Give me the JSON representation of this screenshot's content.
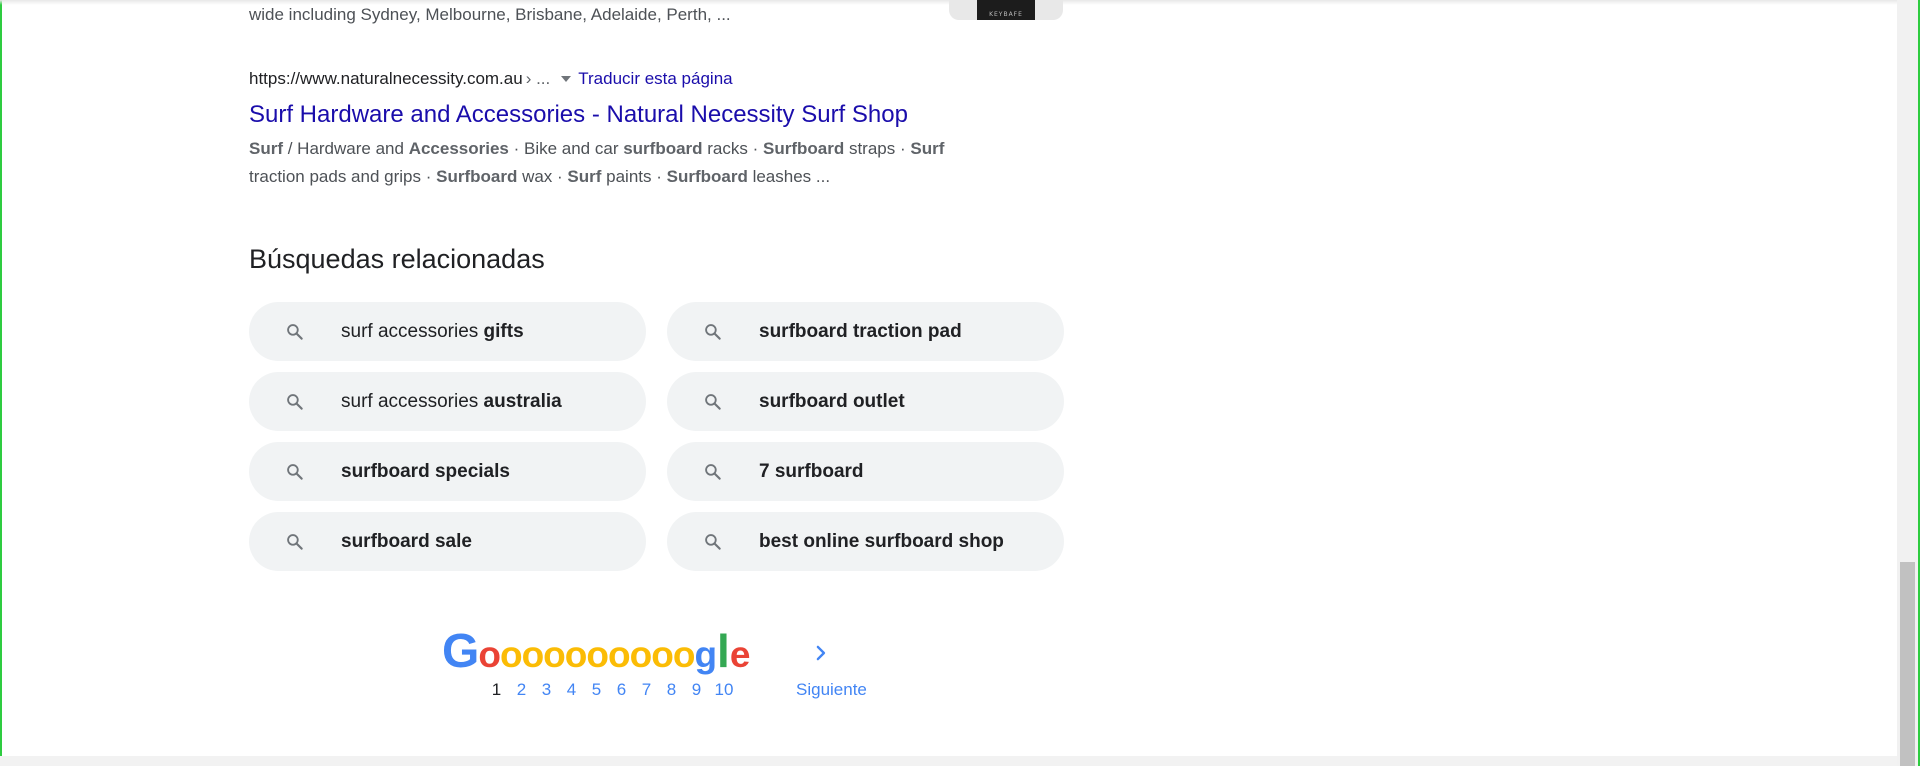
{
  "previous_result": {
    "snippet_tail": "wide including Sydney, Melbourne, Brisbane, Adelaide, Perth, ...",
    "thumbnail_text": "KEYBAFE"
  },
  "result": {
    "url": "https://www.naturalnecessity.com.au",
    "breadcrumb": "› ...",
    "translate_label": "Traducir esta página",
    "title": "Surf Hardware and Accessories - Natural Necessity Surf Shop",
    "snippet_line1": [
      {
        "text": "Surf",
        "bold": true
      },
      {
        "text": " / Hardware and ",
        "bold": false
      },
      {
        "text": "Accessories",
        "bold": true
      },
      {
        "text": " · Bike and car ",
        "bold": false
      },
      {
        "text": "surfboard",
        "bold": true
      },
      {
        "text": " racks · ",
        "bold": false
      },
      {
        "text": "Surfboard",
        "bold": true
      },
      {
        "text": " straps · ",
        "bold": false
      },
      {
        "text": "Surf",
        "bold": true
      }
    ],
    "snippet_line2": [
      {
        "text": "traction pads and grips · ",
        "bold": false
      },
      {
        "text": "Surfboard",
        "bold": true
      },
      {
        "text": " wax · ",
        "bold": false
      },
      {
        "text": "Surf",
        "bold": true
      },
      {
        "text": " paints · ",
        "bold": false
      },
      {
        "text": "Surfboard",
        "bold": true
      },
      {
        "text": " leashes ...",
        "bold": false
      }
    ]
  },
  "related": {
    "heading": "Búsquedas relacionadas",
    "items": [
      {
        "plain": "surf accessories ",
        "bold": "gifts"
      },
      {
        "plain": "",
        "bold": "surfboard traction pad"
      },
      {
        "plain": "surf accessories ",
        "bold": "australia"
      },
      {
        "plain": "",
        "bold": "surfboard outlet"
      },
      {
        "plain": "",
        "bold": "surfboard specials"
      },
      {
        "plain": "",
        "bold": "7 surfboard"
      },
      {
        "plain": "",
        "bold": "surfboard sale"
      },
      {
        "plain": "",
        "bold": "best online surfboard shop"
      }
    ],
    "icon": "search-icon"
  },
  "pagination": {
    "logo_letters": [
      {
        "ch": "G",
        "color": "#4285f4",
        "cls": "g"
      },
      {
        "ch": "o",
        "color": "#ea4335",
        "cls": "o"
      },
      {
        "ch": "o",
        "color": "#fbbc05",
        "cls": "o"
      },
      {
        "ch": "o",
        "color": "#fbbc05",
        "cls": "o"
      },
      {
        "ch": "o",
        "color": "#fbbc05",
        "cls": "o"
      },
      {
        "ch": "o",
        "color": "#fbbc05",
        "cls": "o"
      },
      {
        "ch": "o",
        "color": "#fbbc05",
        "cls": "o"
      },
      {
        "ch": "o",
        "color": "#fbbc05",
        "cls": "o"
      },
      {
        "ch": "o",
        "color": "#fbbc05",
        "cls": "o"
      },
      {
        "ch": "o",
        "color": "#fbbc05",
        "cls": "o"
      },
      {
        "ch": "o",
        "color": "#fbbc05",
        "cls": "o"
      },
      {
        "ch": "g",
        "color": "#4285f4",
        "cls": "o"
      },
      {
        "ch": "l",
        "color": "#34a853",
        "cls": "l"
      },
      {
        "ch": "e",
        "color": "#ea4335",
        "cls": "e"
      }
    ],
    "current_page": "1",
    "pages": [
      "2",
      "3",
      "4",
      "5",
      "6",
      "7",
      "8",
      "9",
      "10"
    ],
    "next_label": "Siguiente",
    "next_icon": "chevron-right-icon"
  },
  "colors": {
    "link": "#1a0dab",
    "pager_link": "#4285f4",
    "chip_bg": "#f1f3f4",
    "window_border": "#2ecc40"
  }
}
